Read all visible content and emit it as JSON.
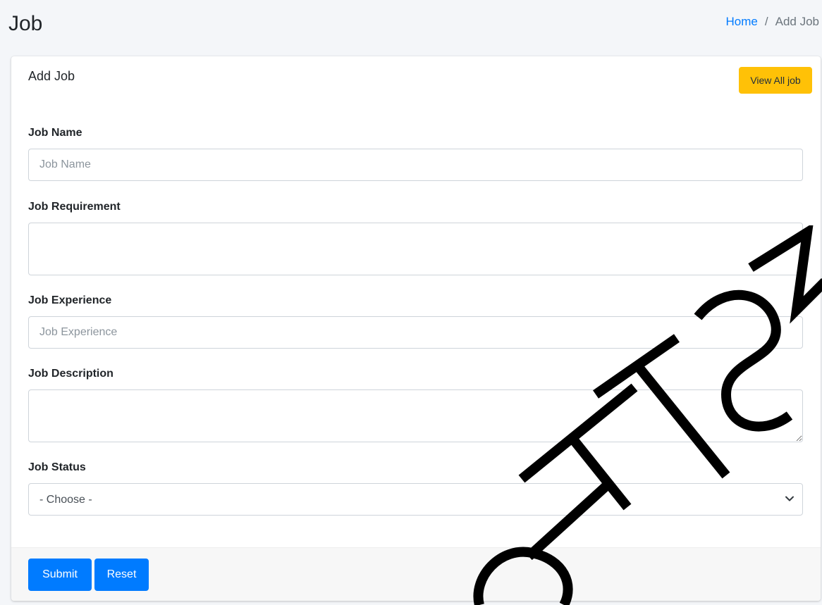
{
  "header": {
    "title": "Job",
    "breadcrumb": {
      "home": "Home",
      "separator": "/",
      "current": "Add Job"
    }
  },
  "card": {
    "title": "Add Job",
    "view_all_label": "View All job"
  },
  "form": {
    "job_name": {
      "label": "Job Name",
      "value": "",
      "placeholder": "Job Name"
    },
    "job_requirement": {
      "label": "Job Requirement",
      "value": ""
    },
    "job_experience": {
      "label": "Job Experience",
      "value": "",
      "placeholder": "Job Experience"
    },
    "job_description": {
      "label": "Job Description",
      "value": ""
    },
    "job_status": {
      "label": "Job Status",
      "selected": "- Choose -",
      "options": [
        "- Choose -"
      ]
    }
  },
  "footer": {
    "submit_label": "Submit",
    "reset_label": "Reset"
  },
  "watermark": {
    "text": "@FTSM"
  },
  "colors": {
    "primary": "#007bff",
    "warning": "#ffc107",
    "background": "#f4f6f9",
    "link": "#007bff"
  }
}
